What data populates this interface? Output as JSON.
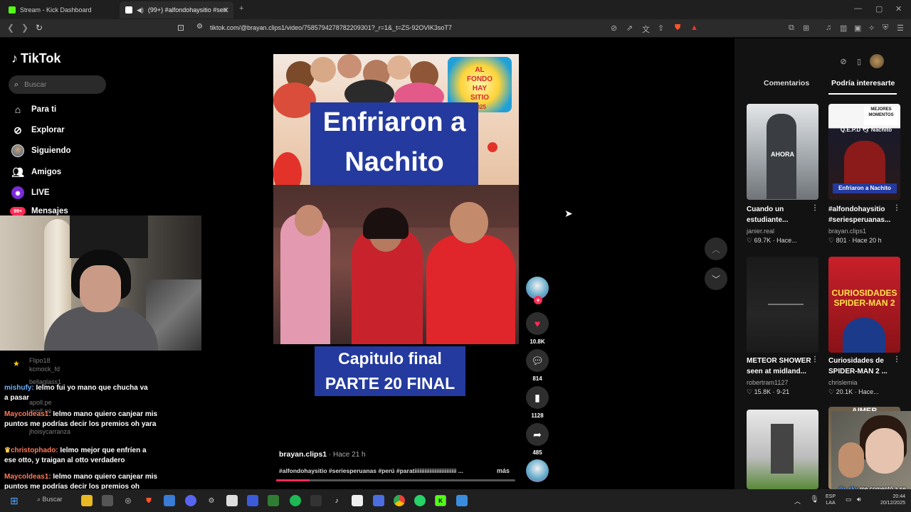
{
  "browser": {
    "tabs": [
      {
        "title": "Stream - Kick Dashboard"
      },
      {
        "title": "(99+) #alfondohaysitio #serie..."
      }
    ],
    "url": "tiktok.com/@brayan.clips1/video/7585794278782209301?_r=1&_t=ZS-92OVIK3soT7"
  },
  "sidebar": {
    "logo": "TikTok",
    "search_placeholder": "Buscar",
    "items": [
      {
        "label": "Para ti",
        "icon": "home-icon"
      },
      {
        "label": "Explorar",
        "icon": "compass-icon"
      },
      {
        "label": "Siguiendo",
        "icon": "following-avatar-icon"
      },
      {
        "label": "Amigos",
        "icon": "friends-icon"
      },
      {
        "label": "LIVE",
        "icon": "live-icon"
      },
      {
        "label": "Mensajes",
        "icon": "messages-icon",
        "badge": "99+"
      }
    ]
  },
  "chat": {
    "ghost_lines": [
      "Flipo18",
      "kcmock_fd",
      "bellaglass1",
      "apoll.pe",
      "apoll.pe",
      "jhoisycarranza"
    ],
    "messages": [
      {
        "user": "mishufy:",
        "text": "Ielmo fui yo mano que chucha va a pasar"
      },
      {
        "user": "Maycoldeas1:",
        "text": "Ielmo mano quiero canjear mis puntos me podrías decir los premios oh yara"
      },
      {
        "user": "christophado:",
        "text": "Ielmo mejor que enfríen a ese otto, y traigan al otto verdadero"
      },
      {
        "user": "Maycoldeas1:",
        "text": "Ielmo mano quiero canjear mis puntos me podrías decir los premios oh YARA"
      }
    ]
  },
  "video": {
    "overlay_title_line1": "Enfriaron a",
    "overlay_title_line2": "Nachito",
    "show_logo_line1": "AL",
    "show_logo_line2": "FONDO",
    "show_logo_line3": "HAY",
    "show_logo_line4": "SITIO",
    "show_logo_line5": "2025",
    "caption_line1": "Capitulo final",
    "caption_line2": "PARTE 20 FINAL",
    "author": "brayan.clips1",
    "posted": " · Hace 21 h",
    "description": "#alfondohaysitio #seriesperuanas #perú #paratiiiiiiiiiiiiiiiiiiiiiiiii ...",
    "more_label": "más",
    "progress": 0.14
  },
  "actions": {
    "likes": "10.8K",
    "comments": "814",
    "saves": "1128",
    "shares": "485"
  },
  "right_panel": {
    "tabs": [
      "Comentarios",
      "Podría interesarte"
    ],
    "active_tab": 1,
    "cards": [
      {
        "title_line1": "Cuando un",
        "title_line2": "estudiante...",
        "author": "janier.real",
        "stats": "♡ 69.7K · Hace...",
        "thumb_text": "AHORA"
      },
      {
        "title_line1": "#alfondohaysitio",
        "title_line2": "#seriesperuanas...",
        "author": "brayan.clips1",
        "stats": "♡ 801 · Hace 20 h",
        "thumb_text": "Enfriaron a Nachito",
        "thumb_top": "MEJORES MOMENTOS",
        "thumb_top2": "Q.E.P.D 🕊 Nachito"
      },
      {
        "title_line1": "METEOR SHOWER",
        "title_line2": "seen at midland...",
        "author": "robertram1127",
        "stats": "♡ 15.8K · 9-21",
        "thumb_text": ""
      },
      {
        "title_line1": "Curiosidades de",
        "title_line2": "SPIDER-MAN 2 ...",
        "author": "chrislemia",
        "stats": "♡ 20.1K · Hace...",
        "thumb_text": "CURIOSIDADES SPIDER-MAN 2"
      },
      {
        "title_line1": "",
        "title_line2": "",
        "author": "",
        "stats": "",
        "thumb_text": ""
      },
      {
        "title_line1": "",
        "title_line2": "",
        "author": "",
        "stats": "",
        "thumb_text": "AIMER"
      }
    ]
  },
  "taskbar": {
    "search_label": "Buscar",
    "lang_line1": "ESP",
    "lang_line2": "LAA",
    "time": "20:44",
    "date": "20/12/2025",
    "overlay_user": "dn_sky",
    "overlay_text": "me comentó a se"
  }
}
